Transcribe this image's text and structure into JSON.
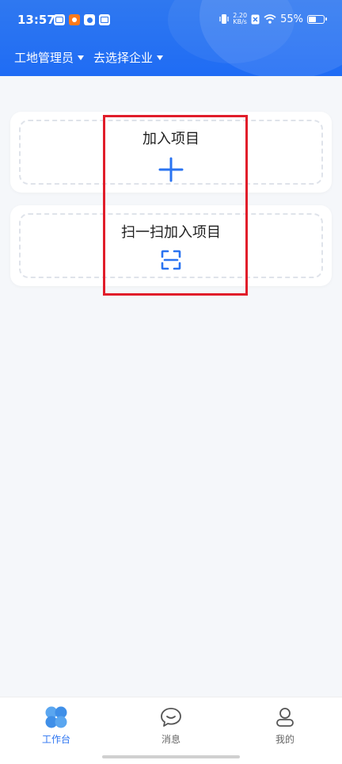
{
  "status_bar": {
    "time": "13:57",
    "net_speed_value": "2.20",
    "net_speed_unit": "KB/s",
    "battery_text": "55%",
    "battery_level": 0.55
  },
  "header": {
    "role_selector": "工地管理员",
    "company_selector": "去选择企业"
  },
  "cards": {
    "join_project": {
      "label": "加入项目",
      "icon": "plus-icon"
    },
    "scan_join_project": {
      "label": "扫一扫加入项目",
      "icon": "scan-icon"
    }
  },
  "tabbar": {
    "items": [
      {
        "label": "工作台",
        "icon": "workbench-icon",
        "active": true
      },
      {
        "label": "消息",
        "icon": "message-icon",
        "active": false
      },
      {
        "label": "我的",
        "icon": "profile-icon",
        "active": false
      }
    ]
  },
  "colors": {
    "primary": "#2a73f1",
    "header_bg": "#1f6cf4",
    "highlight": "#e11d2a",
    "page_bg": "#f5f7fa"
  }
}
